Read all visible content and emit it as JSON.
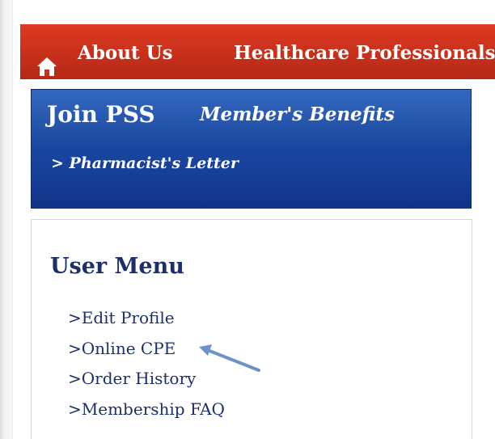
{
  "nav": {
    "items": [
      "About Us",
      "Healthcare Professionals"
    ]
  },
  "join_panel": {
    "title": "Join PSS",
    "benefits": "Member's Benefits",
    "letter": "> Pharmacist's Letter"
  },
  "user_menu": {
    "heading": "User Menu",
    "links": [
      ">Edit Profile",
      ">Online CPE",
      ">Order History",
      ">Membership FAQ"
    ]
  },
  "colors": {
    "nav_red": "#c7301b",
    "panel_blue": "#1b4aa3",
    "menu_text": "#1c2f6b",
    "arrow": "#6b93c7"
  }
}
